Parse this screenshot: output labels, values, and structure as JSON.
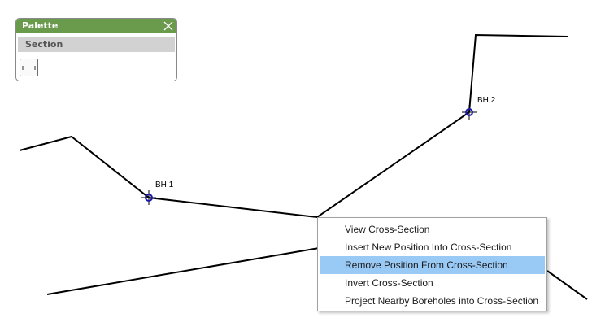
{
  "palette": {
    "title": "Palette",
    "section_label": "Section",
    "tool_icon": "section-line-icon"
  },
  "boreholes": [
    {
      "label": "BH 1"
    },
    {
      "label": "BH 2"
    }
  ],
  "context_menu": {
    "items": [
      {
        "label": "View Cross-Section",
        "highlighted": false
      },
      {
        "label": "Insert New Position Into Cross-Section",
        "highlighted": false
      },
      {
        "label": "Remove Position From Cross-Section",
        "highlighted": true
      },
      {
        "label": "Invert Cross-Section",
        "highlighted": false
      },
      {
        "label": "Project Nearby Boreholes into Cross-Section",
        "highlighted": false
      }
    ]
  },
  "colors": {
    "palette_header": "#6a9a4c",
    "menu_highlight": "#99c9f5",
    "borehole_marker": "#1a1aa8"
  }
}
